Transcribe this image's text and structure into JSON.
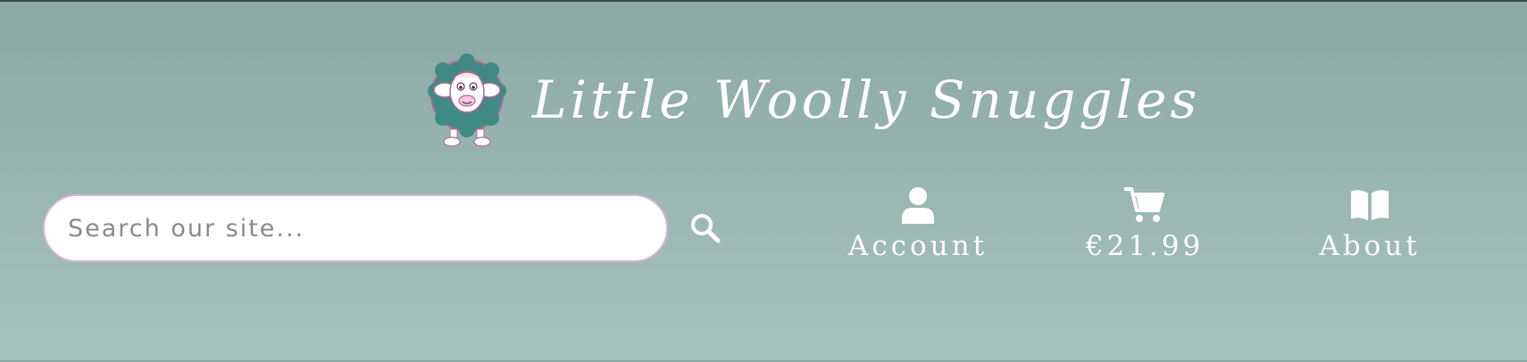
{
  "header": {
    "site_title": "Little Woolly Snuggles"
  },
  "search": {
    "placeholder": "Search our site..."
  },
  "nav": {
    "account_label": "Account",
    "cart_total": "€21.99",
    "about_label": "About"
  },
  "icons": {
    "logo": "sheep-logo",
    "search": "search-icon",
    "account": "person-icon",
    "cart": "cart-icon",
    "about": "book-icon"
  },
  "colors": {
    "background_top": "#8aa8a2",
    "background_bottom": "#a8c2bd",
    "search_border": "#d8b8d4",
    "text": "#ffffff"
  }
}
